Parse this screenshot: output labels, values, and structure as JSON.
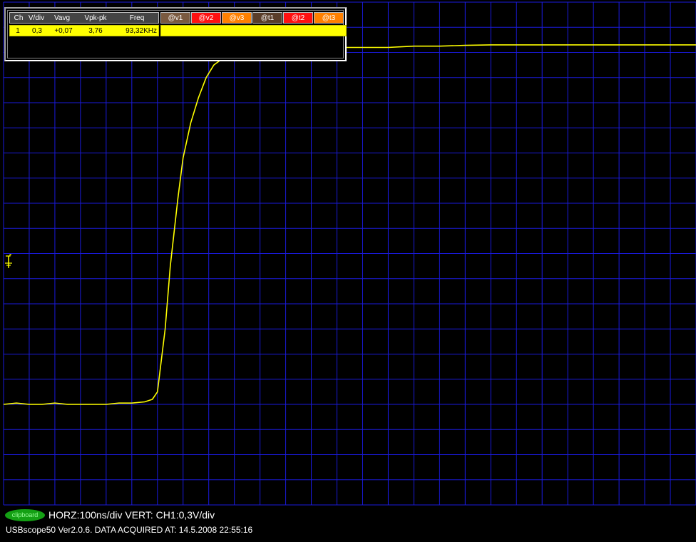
{
  "colors": {
    "background": "#000000",
    "grid": "#1a1adc",
    "trace": "#ffff00",
    "header_bg": "#444444",
    "v1_bg": "#7a5a40",
    "v2_bg": "#ff1010",
    "v3_bg": "#ff8000",
    "t1_bg": "#5a3e2a",
    "t2_bg": "#ff1010",
    "t3_bg": "#ff8000",
    "clipboard_bg": "#14a014"
  },
  "measurements": {
    "headers": [
      "Ch",
      "V/div",
      "Vavg",
      "Vpk-pk",
      "Freq"
    ],
    "cursor_headers": [
      "@v1",
      "@v2",
      "@v3",
      "@t1",
      "@t2",
      "@t3"
    ],
    "rows": [
      {
        "ch": "1",
        "vdiv": "0,3",
        "vavg": "+0,07",
        "vpkpk": "3,76",
        "freq": "93,32KHz"
      }
    ]
  },
  "trigger": {
    "icon": "trigger-level-icon"
  },
  "status": {
    "clipboard_label": "clipboard",
    "scale_text": "HORZ:100ns/div VERT: CH1:0,3V/div",
    "version_text": "USBscope50 Ver2.0.6.  DATA ACQUIRED AT: 14.5.2008 22:55:16"
  },
  "chart_data": {
    "type": "line",
    "title": "",
    "xlabel": "",
    "ylabel": "",
    "x_unit": "div",
    "y_unit": "div",
    "xlim": [
      0,
      27
    ],
    "ylim": [
      -10,
      10
    ],
    "grid": true,
    "series": [
      {
        "values": [
          [
            0.0,
            -6.0
          ],
          [
            0.5,
            -5.95
          ],
          [
            1.0,
            -6.0
          ],
          [
            1.5,
            -6.0
          ],
          [
            2.0,
            -5.95
          ],
          [
            2.5,
            -6.0
          ],
          [
            3.0,
            -6.0
          ],
          [
            3.5,
            -6.0
          ],
          [
            4.0,
            -6.0
          ],
          [
            4.5,
            -5.95
          ],
          [
            5.0,
            -5.95
          ],
          [
            5.5,
            -5.9
          ],
          [
            5.8,
            -5.8
          ],
          [
            6.0,
            -5.5
          ],
          [
            6.3,
            -3.0
          ],
          [
            6.5,
            -0.5
          ],
          [
            6.8,
            2.2
          ],
          [
            7.0,
            3.8
          ],
          [
            7.3,
            5.2
          ],
          [
            7.6,
            6.2
          ],
          [
            7.9,
            7.0
          ],
          [
            8.2,
            7.5
          ],
          [
            8.6,
            7.8
          ],
          [
            9.0,
            8.0
          ],
          [
            9.5,
            8.1
          ],
          [
            10.0,
            8.1
          ],
          [
            11.0,
            8.15
          ],
          [
            12.0,
            8.2
          ],
          [
            13.0,
            8.2
          ],
          [
            14.0,
            8.2
          ],
          [
            15.0,
            8.2
          ],
          [
            16.0,
            8.25
          ],
          [
            17.0,
            8.25
          ],
          [
            18.0,
            8.28
          ],
          [
            19.0,
            8.3
          ],
          [
            20.0,
            8.3
          ],
          [
            21.0,
            8.3
          ],
          [
            22.0,
            8.3
          ],
          [
            23.0,
            8.3
          ],
          [
            24.0,
            8.3
          ],
          [
            25.0,
            8.3
          ],
          [
            26.0,
            8.3
          ],
          [
            27.0,
            8.3
          ]
        ]
      }
    ]
  }
}
